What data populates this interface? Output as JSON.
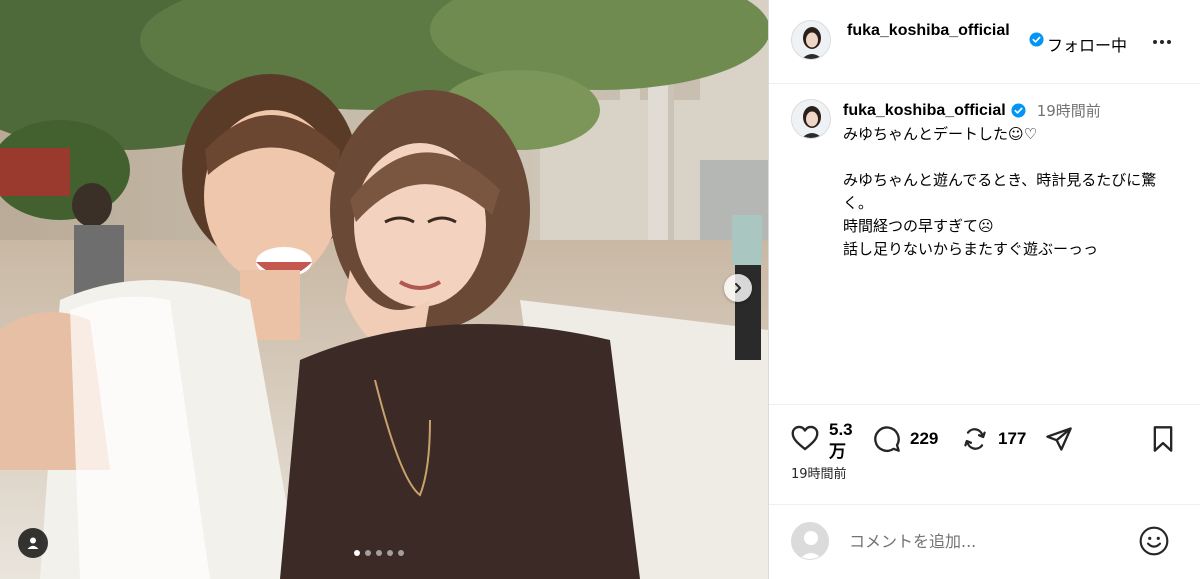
{
  "post": {
    "carousel": {
      "total_images": 5,
      "active_index": 0
    }
  },
  "author": {
    "username": "fuka_koshiba_official",
    "verified": true,
    "follow_label": "フォロー中"
  },
  "caption": {
    "time_ago": "19時間前",
    "lines": [
      "みゆちゃんとデートした☺︎♡",
      "",
      "みゆちゃんと遊んでるとき、時計見るたびに驚く。",
      "時間経つの早すぎて☹︎",
      "話し足りないからまたすぐ遊ぶーっっ"
    ]
  },
  "stats": {
    "likes": "5.3万",
    "comments": "229",
    "reposts": "177"
  },
  "posted_time": "19時間前",
  "comment_box": {
    "placeholder": "コメントを追加..."
  },
  "colors": {
    "verified_badge": "#0095f6",
    "secondary_text": "#737373",
    "divider": "#dbdbdb"
  },
  "icons": {
    "like": "heart-icon",
    "comment": "speech-bubble-icon",
    "repost": "repost-icon",
    "share": "paper-plane-icon",
    "save": "bookmark-icon",
    "more": "more-options-icon",
    "emoji": "smiley-icon",
    "next": "chevron-right-icon",
    "tag": "user-tag-icon"
  }
}
